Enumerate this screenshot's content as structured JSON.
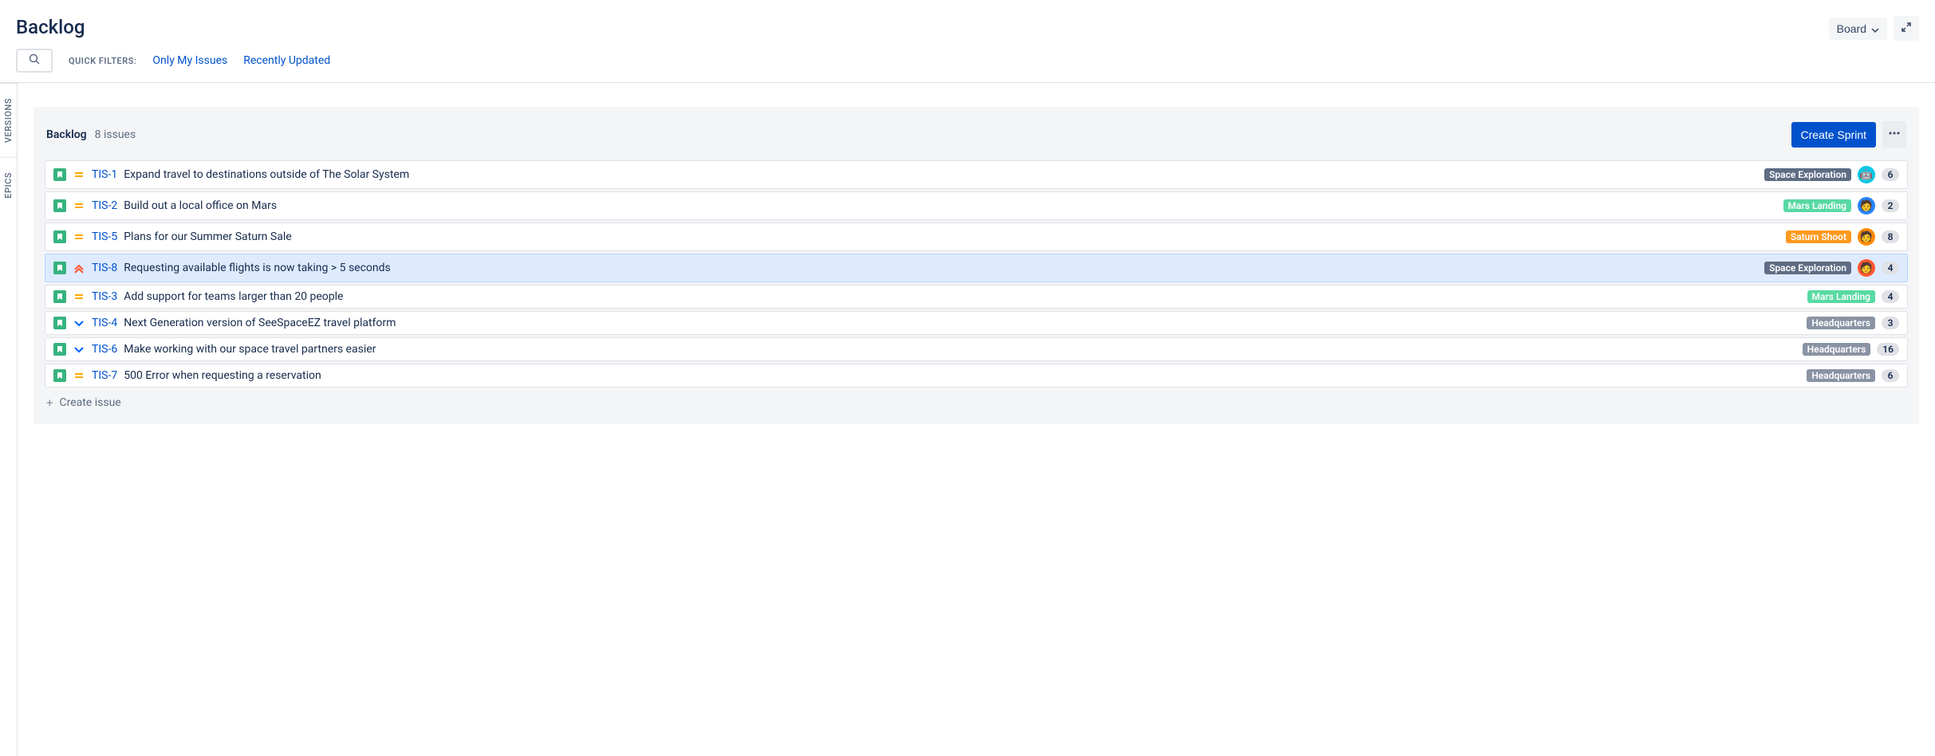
{
  "header": {
    "title": "Backlog",
    "board_label": "Board"
  },
  "filters": {
    "label": "QUICK FILTERS:",
    "only_my": "Only My Issues",
    "recently": "Recently Updated"
  },
  "side": {
    "versions": "VERSIONS",
    "epics": "EPICS"
  },
  "panel": {
    "title": "Backlog",
    "count": "8 issues",
    "create_sprint": "Create Sprint",
    "create_issue": "Create issue"
  },
  "epic_colors": {
    "space_exploration": "#5e6c84",
    "mars_landing": "#57d9a3",
    "saturn_shoot": "#ff991f",
    "headquarters": "#8993a4"
  },
  "issues": [
    {
      "key": "TIS-1",
      "summary": "Expand travel to destinations outside of The Solar System",
      "priority": "medium",
      "epic": "Space Exploration",
      "epic_color": "space_exploration",
      "avatar": "1",
      "avatar_face": "🤖",
      "estimate": "6",
      "selected": false
    },
    {
      "key": "TIS-2",
      "summary": "Build out a local office on Mars",
      "priority": "medium",
      "epic": "Mars Landing",
      "epic_color": "mars_landing",
      "avatar": "2",
      "avatar_face": "🧑",
      "estimate": "2",
      "selected": false
    },
    {
      "key": "TIS-5",
      "summary": "Plans for our Summer Saturn Sale",
      "priority": "medium",
      "epic": "Saturn Shoot",
      "epic_color": "saturn_shoot",
      "avatar": "3",
      "avatar_face": "🧑",
      "estimate": "8",
      "selected": false
    },
    {
      "key": "TIS-8",
      "summary": "Requesting available flights is now taking > 5 seconds",
      "priority": "highest",
      "epic": "Space Exploration",
      "epic_color": "space_exploration",
      "avatar": "4",
      "avatar_face": "🧑",
      "estimate": "4",
      "selected": true
    },
    {
      "key": "TIS-3",
      "summary": "Add support for teams larger than 20 people",
      "priority": "medium",
      "epic": "Mars Landing",
      "epic_color": "mars_landing",
      "avatar": "",
      "avatar_face": "",
      "estimate": "4",
      "selected": false
    },
    {
      "key": "TIS-4",
      "summary": "Next Generation version of SeeSpaceEZ travel platform",
      "priority": "low",
      "epic": "Headquarters",
      "epic_color": "headquarters",
      "avatar": "",
      "avatar_face": "",
      "estimate": "3",
      "selected": false
    },
    {
      "key": "TIS-6",
      "summary": "Make working with our space travel partners easier",
      "priority": "low",
      "epic": "Headquarters",
      "epic_color": "headquarters",
      "avatar": "",
      "avatar_face": "",
      "estimate": "16",
      "selected": false
    },
    {
      "key": "TIS-7",
      "summary": "500 Error when requesting a reservation",
      "priority": "medium",
      "epic": "Headquarters",
      "epic_color": "headquarters",
      "avatar": "",
      "avatar_face": "",
      "estimate": "6",
      "selected": false
    }
  ]
}
